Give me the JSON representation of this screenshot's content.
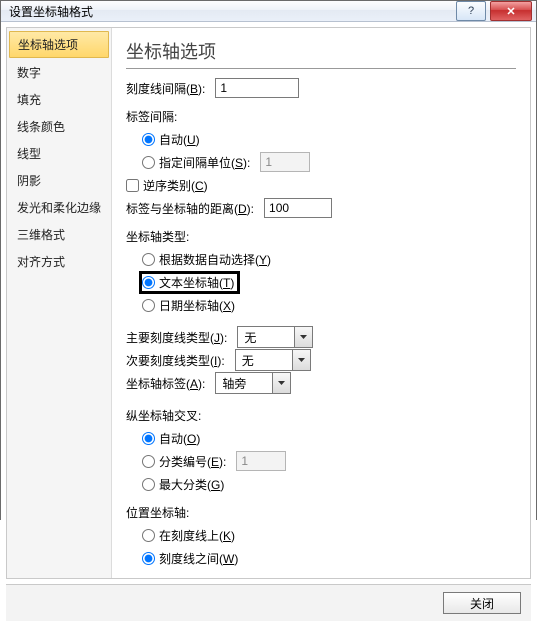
{
  "window": {
    "title": "设置坐标轴格式"
  },
  "titlebar_buttons": {
    "help_aria": "help",
    "close_aria": "close"
  },
  "sidebar": {
    "items": [
      {
        "label": "坐标轴选项",
        "selected": true
      },
      {
        "label": "数字"
      },
      {
        "label": "填充"
      },
      {
        "label": "线条颜色"
      },
      {
        "label": "线型"
      },
      {
        "label": "阴影"
      },
      {
        "label": "发光和柔化边缘"
      },
      {
        "label": "三维格式"
      },
      {
        "label": "对齐方式"
      }
    ]
  },
  "panel": {
    "heading": "坐标轴选项",
    "tick_interval_label_pre": "刻度线间隔(",
    "tick_interval_key": "B",
    "tick_interval_label_post": "):",
    "tick_interval_value": "1",
    "label_interval_title": "标签间隔:",
    "label_interval_auto_pre": "自动(",
    "label_interval_auto_key": "U",
    "label_interval_auto_post": ")",
    "label_interval_spec_pre": "指定间隔单位(",
    "label_interval_spec_key": "S",
    "label_interval_spec_post": "):",
    "label_interval_spec_value": "1",
    "label_interval_choice": "auto",
    "reverse_cat_pre": "逆序类别(",
    "reverse_cat_key": "C",
    "reverse_cat_post": ")",
    "reverse_cat_checked": false,
    "axis_label_distance_pre": "标签与坐标轴的距离(",
    "axis_label_distance_key": "D",
    "axis_label_distance_post": "):",
    "axis_label_distance_value": "100",
    "axis_type_title": "坐标轴类型:",
    "axis_type_auto_pre": "根据数据自动选择(",
    "axis_type_auto_key": "Y",
    "axis_type_auto_post": ")",
    "axis_type_text_pre": "文本坐标轴(",
    "axis_type_text_key": "T",
    "axis_type_text_post": ")",
    "axis_type_date_pre": "日期坐标轴(",
    "axis_type_date_key": "X",
    "axis_type_date_post": ")",
    "axis_type_choice": "text",
    "major_tick_pre": "主要刻度线类型(",
    "major_tick_key": "J",
    "major_tick_post": "):",
    "major_tick_value": "无",
    "minor_tick_pre": "次要刻度线类型(",
    "minor_tick_key": "I",
    "minor_tick_post": "):",
    "minor_tick_value": "无",
    "axis_labels_pre": "坐标轴标签(",
    "axis_labels_key": "A",
    "axis_labels_post": "):",
    "axis_labels_value": "轴旁",
    "vcross_title": "纵坐标轴交叉:",
    "vcross_auto_pre": "自动(",
    "vcross_auto_key": "O",
    "vcross_auto_post": ")",
    "vcross_cat_pre": "分类编号(",
    "vcross_cat_key": "E",
    "vcross_cat_post": "):",
    "vcross_cat_value": "1",
    "vcross_max_pre": "最大分类(",
    "vcross_max_key": "G",
    "vcross_max_post": ")",
    "vcross_choice": "auto",
    "pos_title": "位置坐标轴:",
    "pos_on_pre": "在刻度线上(",
    "pos_on_key": "K",
    "pos_on_post": ")",
    "pos_between_pre": "刻度线之间(",
    "pos_between_key": "W",
    "pos_between_post": ")",
    "pos_choice": "between"
  },
  "footer": {
    "close": "关闭"
  }
}
